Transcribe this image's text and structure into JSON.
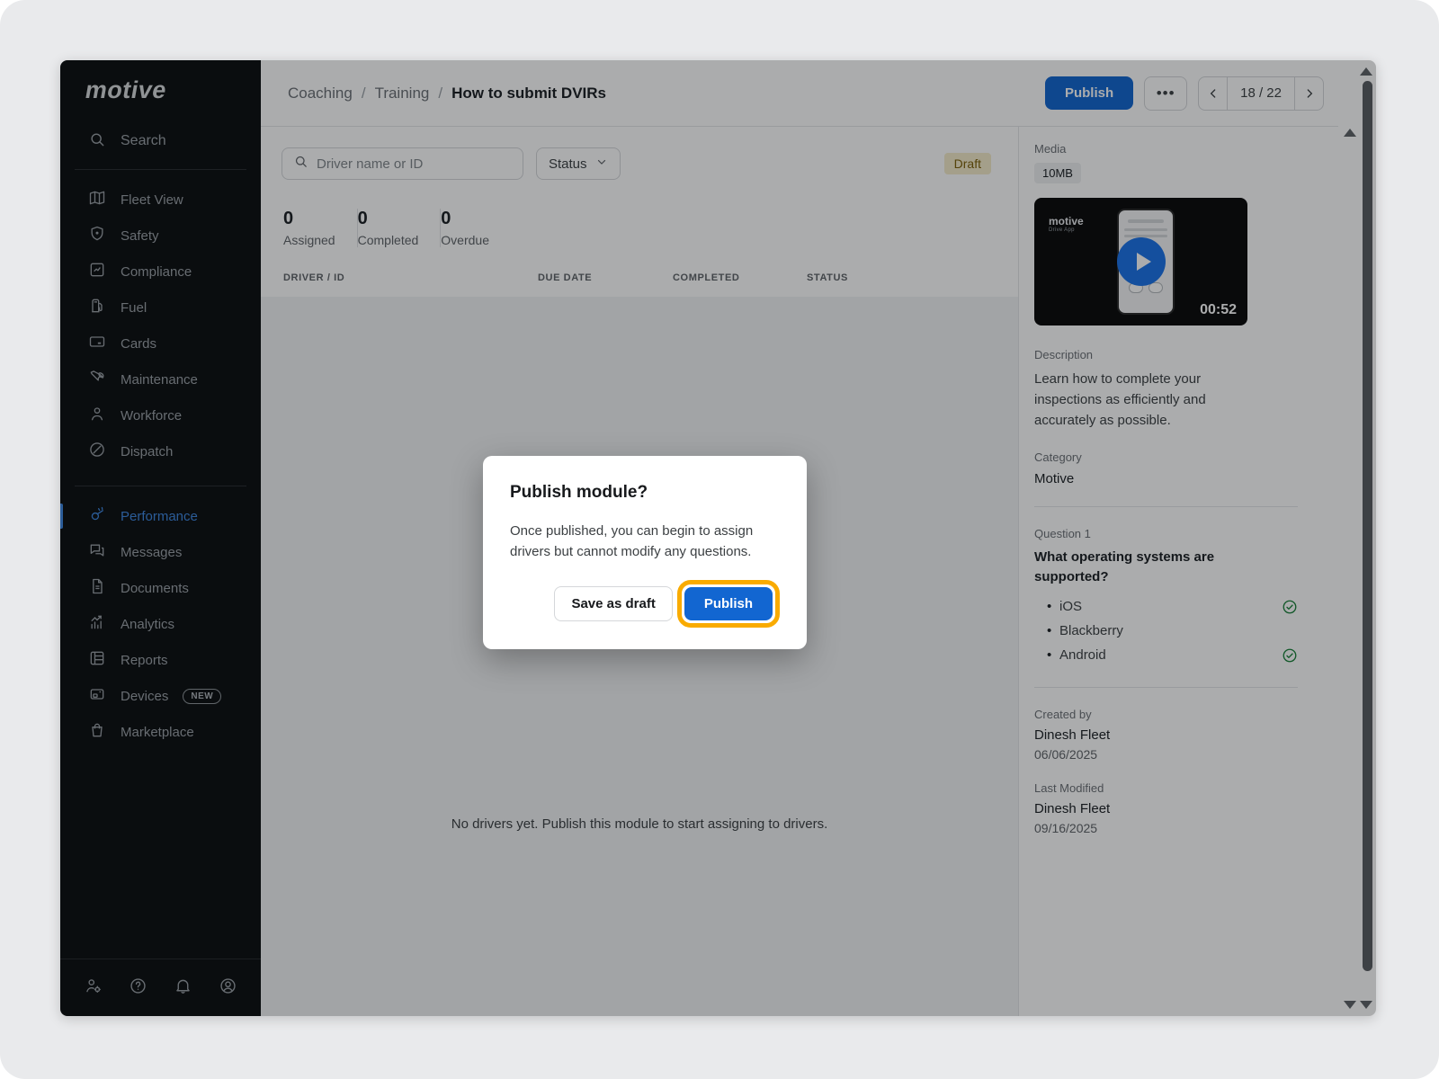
{
  "brand": {
    "logo_text": "motive"
  },
  "sidebar": {
    "search_label": "Search",
    "items": [
      {
        "label": "Fleet View"
      },
      {
        "label": "Safety"
      },
      {
        "label": "Compliance"
      },
      {
        "label": "Fuel"
      },
      {
        "label": "Cards"
      },
      {
        "label": "Maintenance"
      },
      {
        "label": "Workforce"
      },
      {
        "label": "Dispatch"
      },
      {
        "label": "Performance"
      },
      {
        "label": "Messages"
      },
      {
        "label": "Documents"
      },
      {
        "label": "Analytics"
      },
      {
        "label": "Reports"
      },
      {
        "label": "Devices",
        "badge": "NEW"
      },
      {
        "label": "Marketplace"
      }
    ]
  },
  "header": {
    "breadcrumb_1": "Coaching",
    "breadcrumb_2": "Training",
    "separator": "/",
    "current_page": "How to submit DVIRs",
    "publish_label": "Publish",
    "more_icon": "•••",
    "pagination": {
      "display": "18 / 22"
    }
  },
  "filters": {
    "search_placeholder": "Driver name or ID",
    "status_label": "Status",
    "draft_badge": "Draft"
  },
  "stats": [
    {
      "value": "0",
      "label": "Assigned"
    },
    {
      "value": "0",
      "label": "Completed"
    },
    {
      "value": "0",
      "label": "Overdue"
    }
  ],
  "table": {
    "col_driver": "DRIVER / ID",
    "col_due": "DUE DATE",
    "col_completed": "COMPLETED",
    "col_status": "STATUS"
  },
  "empty_state": "No drivers yet. Publish this module to start assigning to drivers.",
  "modal": {
    "title": "Publish module?",
    "body": "Once published, you can begin to assign drivers but cannot modify any questions.",
    "save_draft_label": "Save as draft",
    "publish_label": "Publish"
  },
  "right_panel": {
    "media_label": "Media",
    "media_size": "10MB",
    "video": {
      "duration": "00:52",
      "brand": "motive",
      "brand_sub": "Drive App"
    },
    "description_label": "Description",
    "description": "Learn how to complete your inspections as efficiently and accurately as possible.",
    "category_label": "Category",
    "category": "Motive",
    "question_label": "Question 1",
    "question": "What operating systems are supported?",
    "options": [
      {
        "label": "iOS",
        "correct": true
      },
      {
        "label": "Blackberry",
        "correct": false
      },
      {
        "label": "Android",
        "correct": true
      }
    ],
    "created_by_label": "Created by",
    "created_by": "Dinesh Fleet",
    "created_date": "06/06/2025",
    "modified_label": "Last Modified",
    "modified_by": "Dinesh Fleet",
    "modified_date": "09/16/2025"
  },
  "colors": {
    "accent_blue": "#1266d1",
    "annotation_ring": "#f9ab00",
    "draft_bg": "#f5ecca",
    "draft_text": "#7c5e06",
    "correct_green": "#188038",
    "sidebar_bg": "#0c0e10"
  }
}
